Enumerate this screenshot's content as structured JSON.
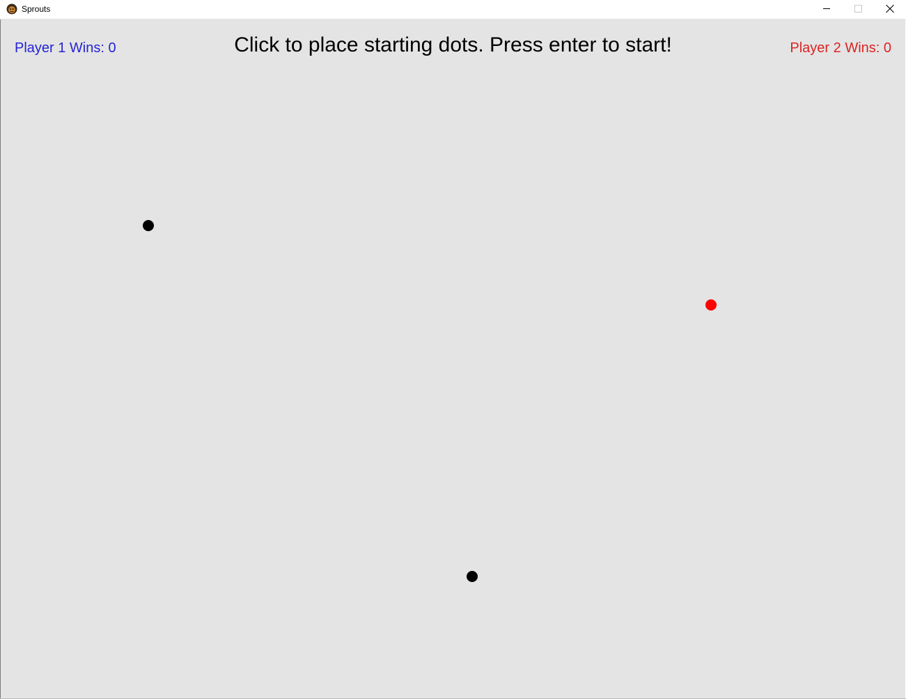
{
  "window": {
    "title": "Sprouts",
    "app_icon": "sprouts-app-icon",
    "controls": [
      "minimize-icon",
      "maximize-icon",
      "close-icon"
    ]
  },
  "hud": {
    "player1_score": "Player 1 Wins: 0",
    "player2_score": "Player 2 Wins: 0",
    "instruction": "Click to place starting dots. Press enter to start!"
  },
  "colors": {
    "player1": "#2323d6",
    "player2": "#dc2323",
    "board_background": "#e4e4e4",
    "dot_default": "#000000",
    "dot_selected": "#ff0000"
  },
  "dots": [
    {
      "color": "#000000",
      "state": "placed"
    },
    {
      "color": "#ff0000",
      "state": "selected"
    },
    {
      "color": "#000000",
      "state": "placed"
    }
  ]
}
